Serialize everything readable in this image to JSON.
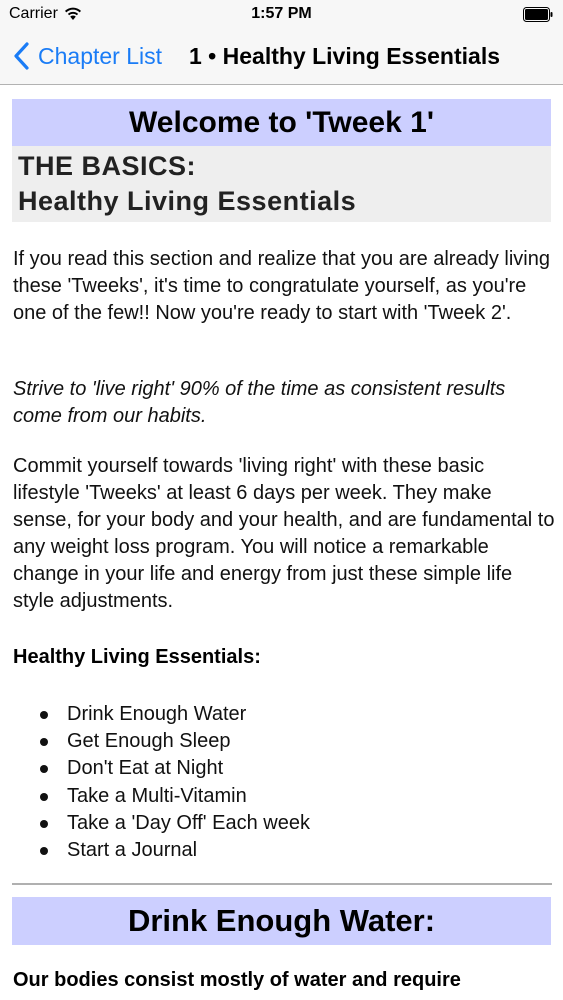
{
  "status_bar": {
    "carrier": "Carrier",
    "time": "1:57 PM"
  },
  "nav": {
    "back_label": "Chapter List",
    "title": "1 • Healthy Living Essentials"
  },
  "article": {
    "welcome_heading": "Welcome to 'Tweek 1'",
    "basics_line1": "THE BASICS:",
    "basics_line2": "Healthy Living Essentials",
    "paragraph1": "If you read this section and realize that you are already living these 'Tweeks', it's time to congratulate yourself, as you're one of the few!! Now you're ready to start with 'Tweek 2'.",
    "paragraph2": "Strive to 'live right' 90% of the time as consistent results come from our habits.",
    "paragraph3": "Commit yourself towards 'living right' with these basic lifestyle 'Tweeks' at least 6 days per week. They make sense, for your body and your health, and are fundamental to any weight loss program. You will notice a remarkable change in your life and energy from just these simple life style adjustments.",
    "essentials_heading": "Healthy Living Essentials:",
    "essentials": [
      "Drink Enough Water",
      "Get Enough Sleep",
      "Don't Eat at Night",
      "Take a Multi-Vitamin",
      "Take a 'Day Off' Each week",
      "Start a Journal"
    ],
    "water_heading": "Drink Enough Water:",
    "water_intro": "Our bodies consist mostly of water and require"
  },
  "colors": {
    "accent": "#1a7cf6",
    "banner": "#cccfff",
    "basics_bg": "#eeeeee"
  },
  "icons": {
    "wifi": "wifi-icon",
    "battery": "battery-icon",
    "back": "chevron-left-icon"
  }
}
